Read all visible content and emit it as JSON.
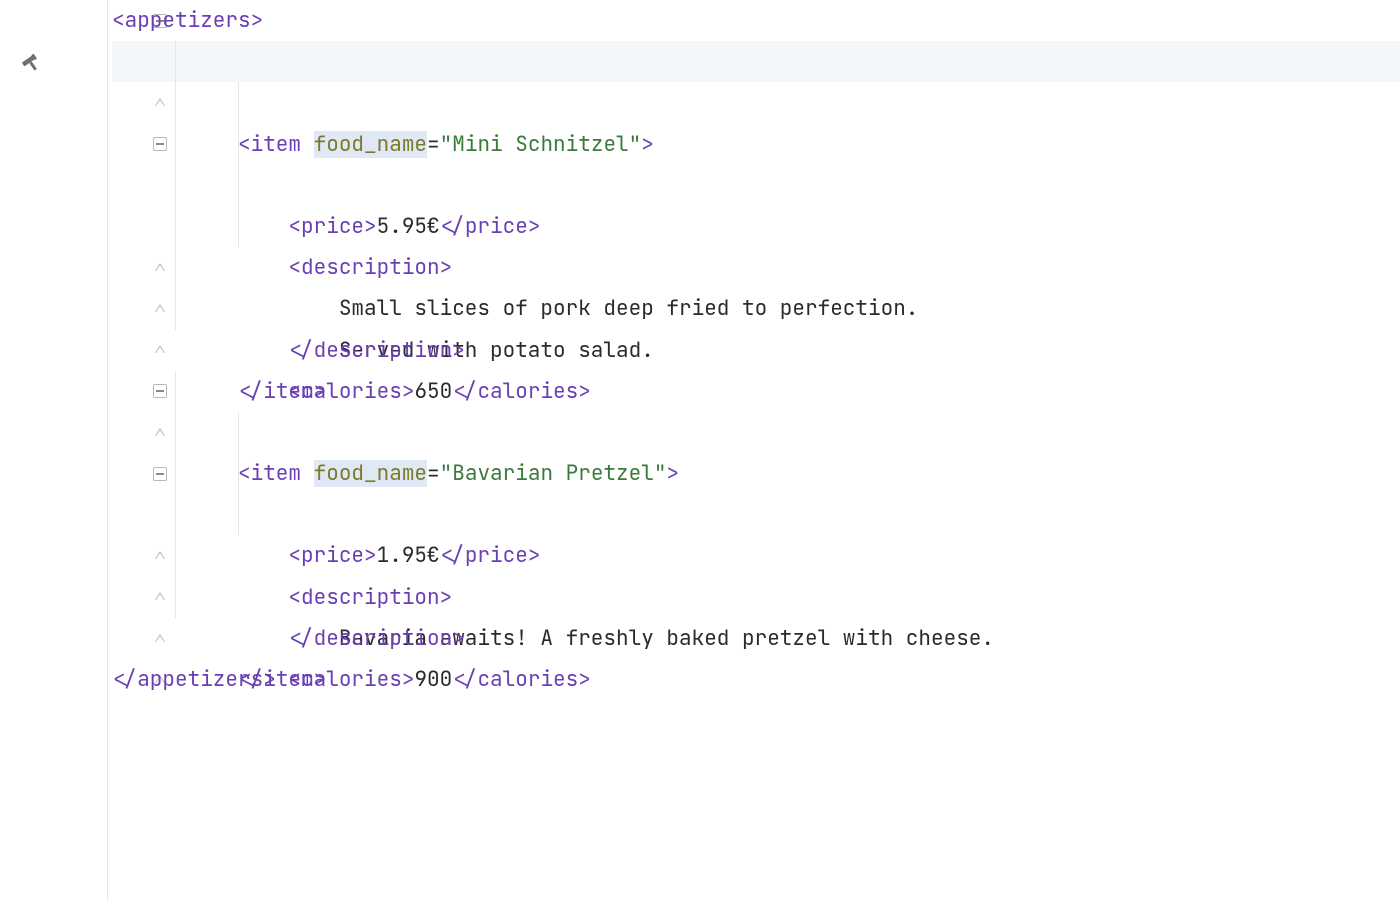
{
  "colors": {
    "tag": "#6a3fb5",
    "attr": "#7a7b2a",
    "string": "#3a7a3a",
    "text": "#2b2b2b",
    "attr_highlight_bg": "#e0e8f5",
    "row_highlight_bg": "#f4f7fa",
    "guide": "#e6e6e6"
  },
  "gutter": {
    "build_icon": "hammer-icon",
    "build_icon_line": 2
  },
  "code": {
    "root_tag": "appetizers",
    "item_tag": "item",
    "attr_name": "food_name",
    "price_tag": "price",
    "desc_tag": "description",
    "cal_tag": "calories",
    "items": [
      {
        "food_name": "Mini Schnitzel",
        "price": "5.95€",
        "description_lines": [
          "Small slices of pork deep fried to perfection.",
          "Served with potato salad."
        ],
        "calories": "650"
      },
      {
        "food_name": "Bavarian Pretzel",
        "price": "1.95€",
        "description_lines": [
          "Bavaria awaits! A freshly baked pretzel with cheese."
        ],
        "calories": "900"
      }
    ]
  }
}
